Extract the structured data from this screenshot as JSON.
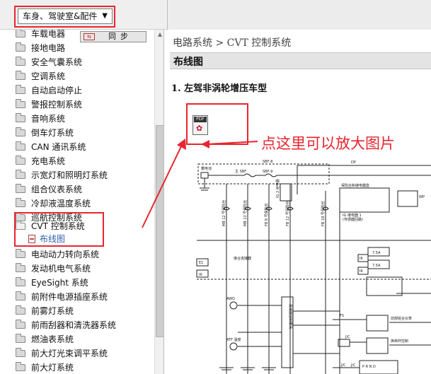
{
  "toolbar": {
    "category_select_value": "车身、驾驶室&配件",
    "sync_button_label": "同步",
    "sync_icon_text": "⇆"
  },
  "nav": {
    "items": [
      {
        "label": "车载电器",
        "partially_hidden": true
      },
      {
        "label": "接地电路"
      },
      {
        "label": "安全气囊系统"
      },
      {
        "label": "空调系统"
      },
      {
        "label": "自动启动停止"
      },
      {
        "label": "警报控制系统"
      },
      {
        "label": "音响系统"
      },
      {
        "label": "倒车灯系统"
      },
      {
        "label": "CAN 通讯系统"
      },
      {
        "label": "充电系统"
      },
      {
        "label": "示宽灯和照明灯系统"
      },
      {
        "label": "组合仪表系统"
      },
      {
        "label": "冷却液温度系统"
      },
      {
        "label": "巡航控制系统"
      },
      {
        "label": "CVT 控制系统",
        "expanded": true
      },
      {
        "label": "电动动力转向系统"
      },
      {
        "label": "发动机电气系统"
      },
      {
        "label": "EyeSight 系统"
      },
      {
        "label": "前附件电源插座系统"
      },
      {
        "label": "前雾灯系统"
      },
      {
        "label": "前雨刮器和清洗器系统"
      },
      {
        "label": "燃油表系统"
      },
      {
        "label": "前大灯光束调平系统"
      },
      {
        "label": "前大灯系统"
      }
    ],
    "sub_item": {
      "label": "布线图"
    }
  },
  "content": {
    "breadcrumb": "电路系统 > CVT 控制系统",
    "section_title": "布线图",
    "subtitle": "1. 左驾非涡轮增压车型",
    "pdf_icon_label": "PDF",
    "annotation_text": "点这里可以放大图片"
  },
  "diagram": {
    "labels": {
      "main_relay": "主 SBF",
      "sbf8": "SBF-8",
      "sbf9": "SBF-9",
      "dp": "DP",
      "wp": "WP",
      "battery": "蓄电池",
      "ig2": "IG 2 继电器",
      "ig_relay": "IG 继电器 1",
      "ig_sub": "(传感器回路)",
      "f_label": "保险丝和继电器盒",
      "joint": "接合连接器",
      "e1": "E1",
      "i6": "I6",
      "i6b": "I6",
      "i6c": "I6",
      "seven_five": "7.5A",
      "seven_five_b": "7.5A",
      "awd": "AWD",
      "atf": "ATF 温度",
      "fs": "FS",
      "jc": "J/C",
      "jc2": "J/C",
      "jc3": "J/C",
      "prnd": "P R N D",
      "cvt_ecu": "变速器控制模块",
      "fuse_mb12": "MB 12 号保险丝",
      "fuse_mb13": "MB 13 号保险丝",
      "fuse_fb8": "FB 8 号保险丝",
      "fuse_fb12": "FB 12 号保险丝",
      "fuse_fb18": "FB 18 号保险丝",
      "front_meter": "前部组合仪表",
      "shift_lever": "换档杆控制"
    }
  },
  "colors": {
    "highlight_red": "#e8262f",
    "link_blue": "#3060b0",
    "section_bar": "#e4e4e4"
  }
}
